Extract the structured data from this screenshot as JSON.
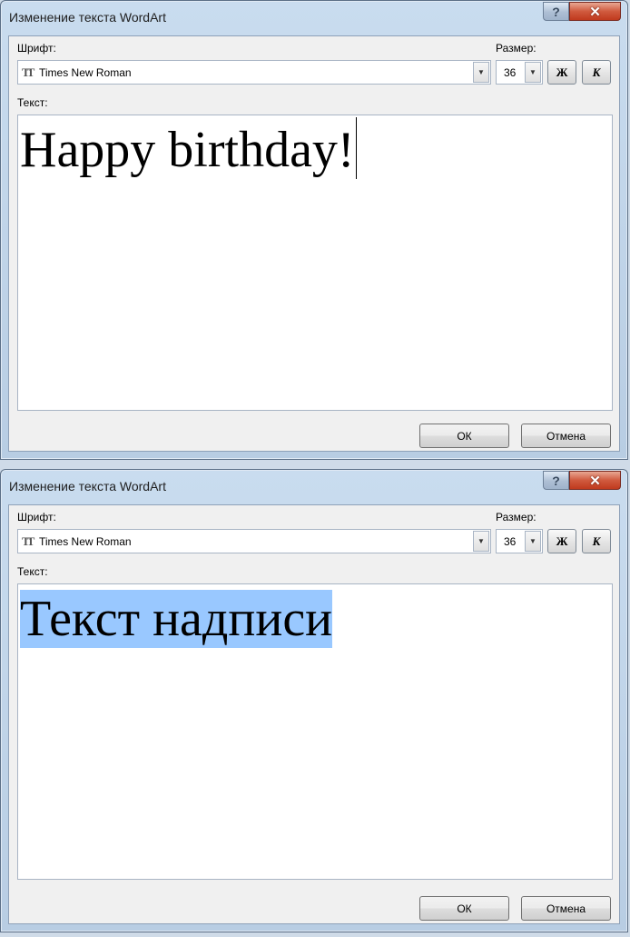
{
  "dialogs": [
    {
      "title": "Изменение текста WordArt",
      "help_label": "?",
      "close_label": "✕",
      "font_label": "Шрифт:",
      "font_icon": "TT",
      "font_value": "Times New Roman",
      "dropdown_arrow": "▼",
      "size_label": "Размер:",
      "size_value": "36",
      "bold_label": "Ж",
      "italic_label": "К",
      "text_label": "Текст:",
      "text_value": "Happy birthday!",
      "ok_label": "ОК",
      "cancel_label": "Отмена"
    },
    {
      "title": "Изменение текста WordArt",
      "help_label": "?",
      "close_label": "✕",
      "font_label": "Шрифт:",
      "font_icon": "TT",
      "font_value": "Times New Roman",
      "dropdown_arrow": "▼",
      "size_label": "Размер:",
      "size_value": "36",
      "bold_label": "Ж",
      "italic_label": "К",
      "text_label": "Текст:",
      "text_value": "Текст надписи",
      "ok_label": "ОК",
      "cancel_label": "Отмена"
    }
  ],
  "colors": {
    "selection": "#99c8ff",
    "close_button": "#c03a1e",
    "frame": "#b8cde3"
  }
}
